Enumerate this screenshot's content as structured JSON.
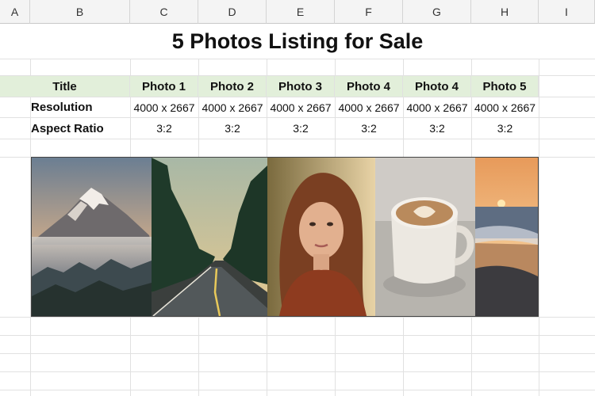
{
  "column_headers": [
    "A",
    "B",
    "C",
    "D",
    "E",
    "F",
    "G",
    "H",
    "I"
  ],
  "sheet_title": "5 Photos Listing for Sale",
  "table": {
    "header_label": "Title",
    "photo_headers": [
      "Photo 1",
      "Photo 2",
      "Photo 3",
      "Photo 4",
      "Photo 4",
      "Photo 5"
    ],
    "rows": [
      {
        "label": "Resolution",
        "values": [
          "4000 x 2667",
          "4000 x 2667",
          "4000 x 2667",
          "4000 x 2667",
          "4000 x 2667",
          "4000 x 2667"
        ]
      },
      {
        "label": "Aspect Ratio",
        "values": [
          "3:2",
          "3:2",
          "3:2",
          "3:2",
          "3:2",
          "3:2"
        ]
      }
    ]
  },
  "photos": [
    "mountain-photo",
    "forest-road-photo",
    "woman-portrait-photo",
    "coffee-cup-photo",
    "sunset-beach-photo"
  ],
  "colors": {
    "header_fill": "#e2efda",
    "gridline": "#e1e1e1",
    "column_header_fill": "#f4f4f4"
  }
}
